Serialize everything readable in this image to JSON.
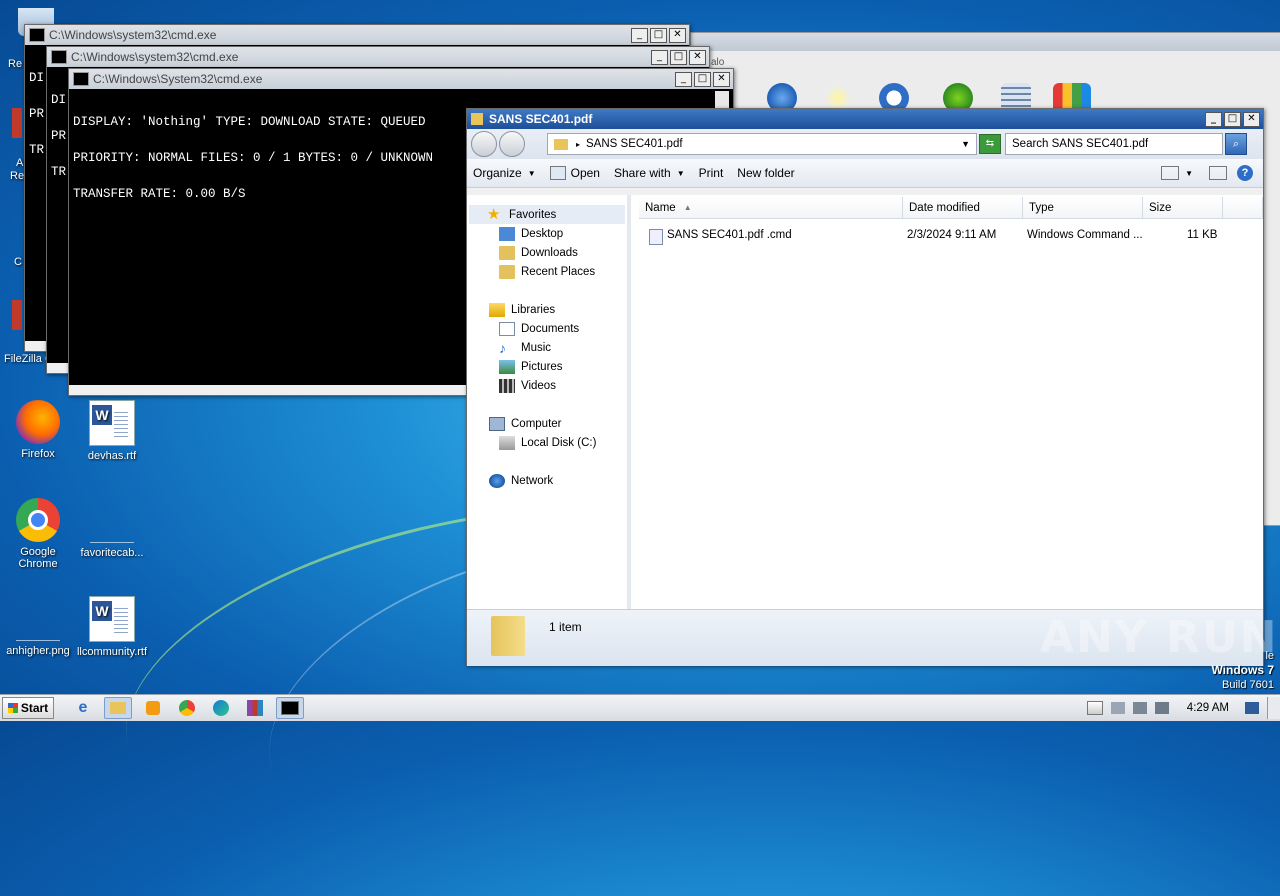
{
  "desktop": {
    "icons": [
      {
        "label": "Firefox"
      },
      {
        "label": "devhas.rtf"
      },
      {
        "label": "Google Chrome"
      },
      {
        "label": "favoritecab..."
      },
      {
        "label": "anhigher.png"
      },
      {
        "label": "llcommunity.rtf"
      }
    ],
    "left_edge_labels": [
      "Re",
      "A",
      "Re",
      "C",
      "FileZilla C"
    ],
    "partial_label": "alo",
    "os_text": {
      "line1": "le",
      "line2": "Windows 7",
      "line3": "Build 7601"
    },
    "watermark": "ANY RUN"
  },
  "cmd_windows": [
    {
      "title": "C:\\Windows\\system32\\cmd.exe",
      "peek_lines": [
        "DI",
        "PR",
        "TR"
      ]
    },
    {
      "title": "C:\\Windows\\system32\\cmd.exe",
      "peek_lines": [
        "DI",
        "PR",
        "TR"
      ]
    },
    {
      "title": "C:\\Windows\\System32\\cmd.exe",
      "lines": [
        "DISPLAY: 'Nothing' TYPE: DOWNLOAD STATE: QUEUED",
        "PRIORITY: NORMAL FILES: 0 / 1 BYTES: 0 / UNKNOWN",
        "TRANSFER RATE: 0.00 B/S"
      ]
    }
  ],
  "window_controls": {
    "minimize": "_",
    "maximize": "□",
    "close": "✕"
  },
  "explorer": {
    "title": "SANS SEC401.pdf",
    "address": "SANS SEC401.pdf",
    "search_placeholder": "Search SANS SEC401.pdf",
    "toolbar": {
      "organize": "Organize",
      "open": "Open",
      "share_with": "Share with",
      "print": "Print",
      "new_folder": "New folder"
    },
    "nav": {
      "favorites": "Favorites",
      "desktop": "Desktop",
      "downloads": "Downloads",
      "recent_places": "Recent Places",
      "libraries": "Libraries",
      "documents": "Documents",
      "music": "Music",
      "pictures": "Pictures",
      "videos": "Videos",
      "computer": "Computer",
      "local_disk": "Local Disk (C:)",
      "network": "Network"
    },
    "columns": {
      "name": "Name",
      "date_modified": "Date modified",
      "type": "Type",
      "size": "Size"
    },
    "files": [
      {
        "name": "SANS SEC401.pdf .cmd",
        "date_modified": "2/3/2024 9:11 AM",
        "type": "Windows Command ...",
        "size": "11 KB"
      }
    ],
    "status": "1 item"
  },
  "taskbar": {
    "start": "Start",
    "clock": "4:29 AM"
  },
  "icons": {
    "ie": "ie-icon",
    "explorer": "folder-icon",
    "media": "media-player-icon",
    "chrome": "chrome-icon",
    "edge": "edge-icon",
    "winrar": "winrar-icon",
    "cmd": "cmd-icon"
  }
}
